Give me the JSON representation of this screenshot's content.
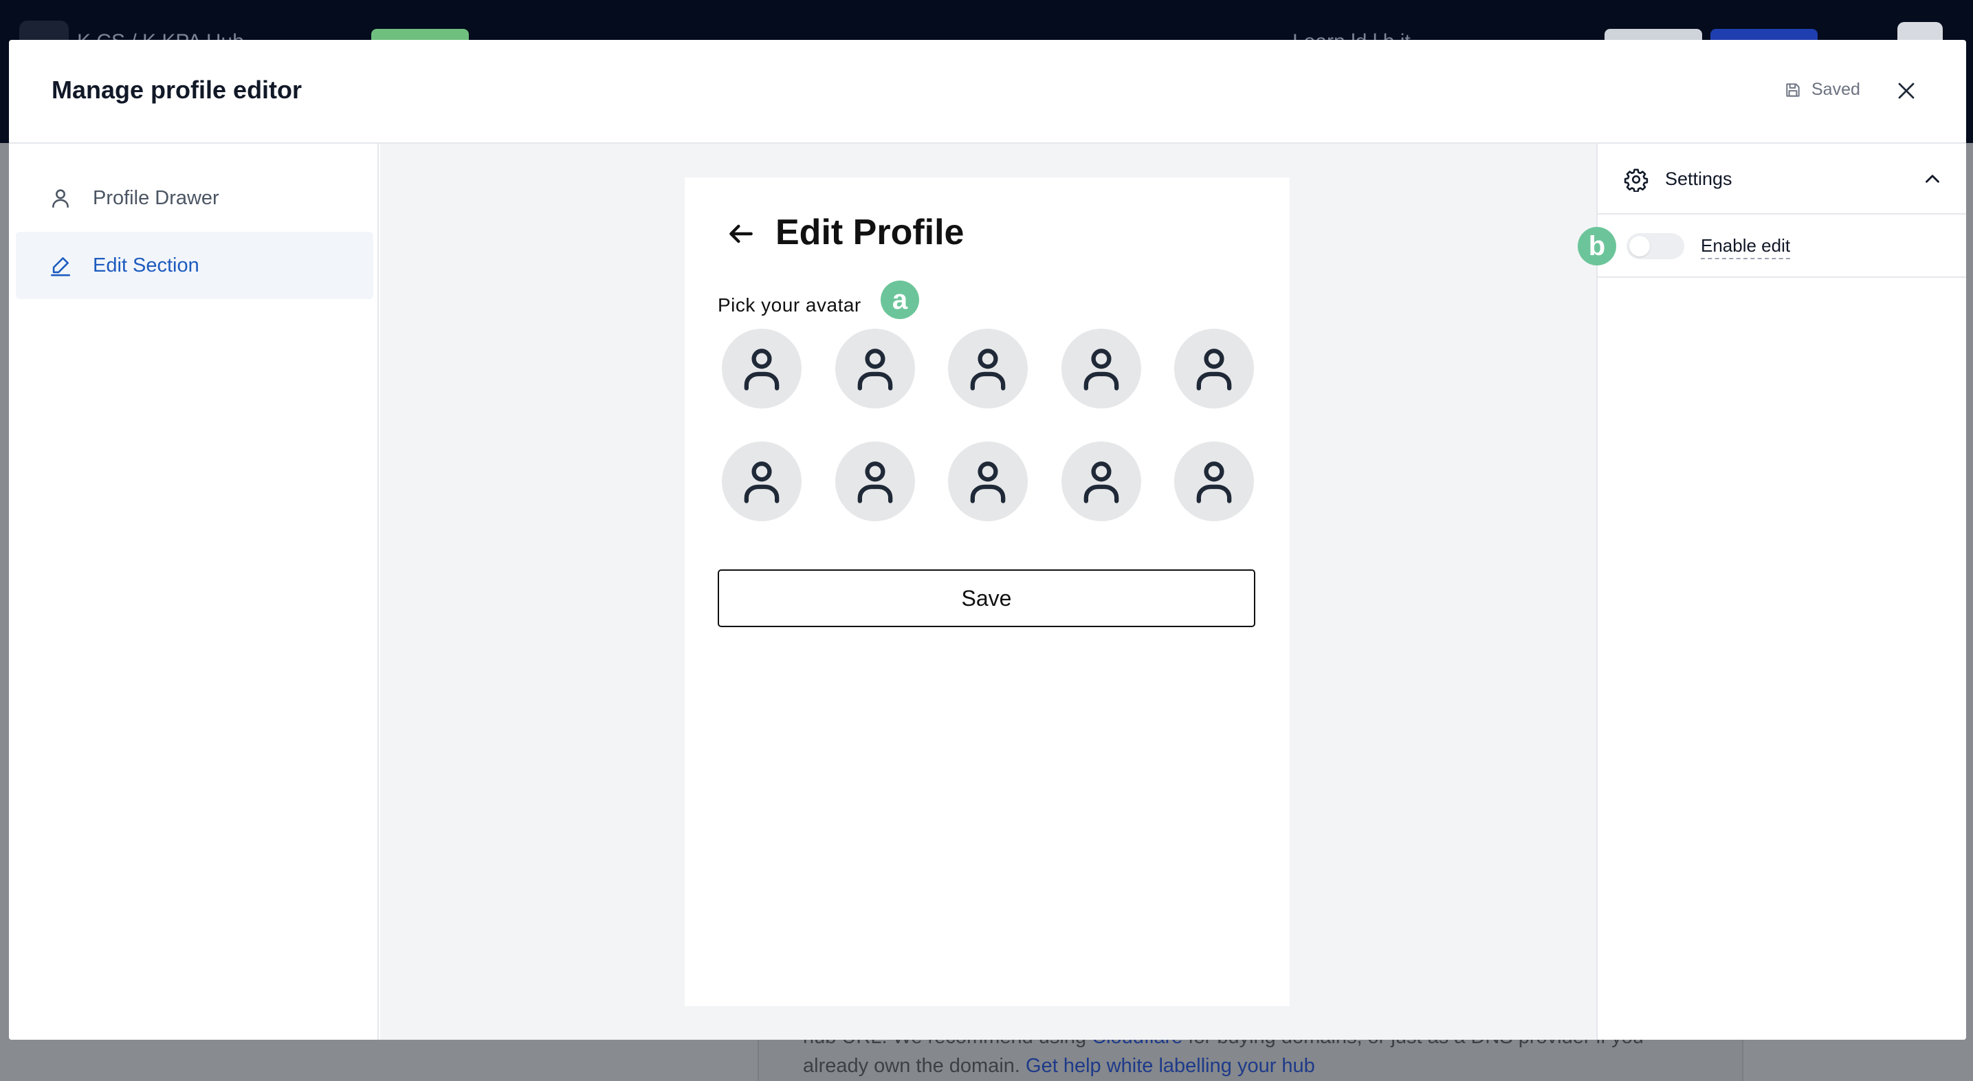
{
  "background": {
    "breadcrumb": "K      CS  /  K      KPA Hub",
    "help_text": "Learn    ld      l    b      it",
    "body_line1": "hub URL. We recommend using ",
    "body_link1": "Cloudflare",
    "body_line1_rest": " for buying domains, or just as a DNS provider if you",
    "body_line2": "already own the domain.  ",
    "body_link2": "Get help white labelling your hub"
  },
  "modal": {
    "title": "Manage profile editor",
    "saved_label": "Saved"
  },
  "nav": {
    "items": [
      {
        "label": "Profile Drawer",
        "icon": "user-icon",
        "active": false
      },
      {
        "label": "Edit Section",
        "icon": "pencil-icon",
        "active": true
      }
    ]
  },
  "preview": {
    "heading": "Edit Profile",
    "avatar_label": "Pick your avatar",
    "avatar_count": 10,
    "save_label": "Save"
  },
  "settings": {
    "title": "Settings",
    "enable_edit_label": "Enable edit",
    "enable_edit_on": false
  },
  "markers": {
    "a": "a",
    "b": "b"
  },
  "colors": {
    "accent_blue": "#1d5bbf",
    "marker_green": "#6cc59a",
    "canvas_bg": "#f3f4f6"
  }
}
